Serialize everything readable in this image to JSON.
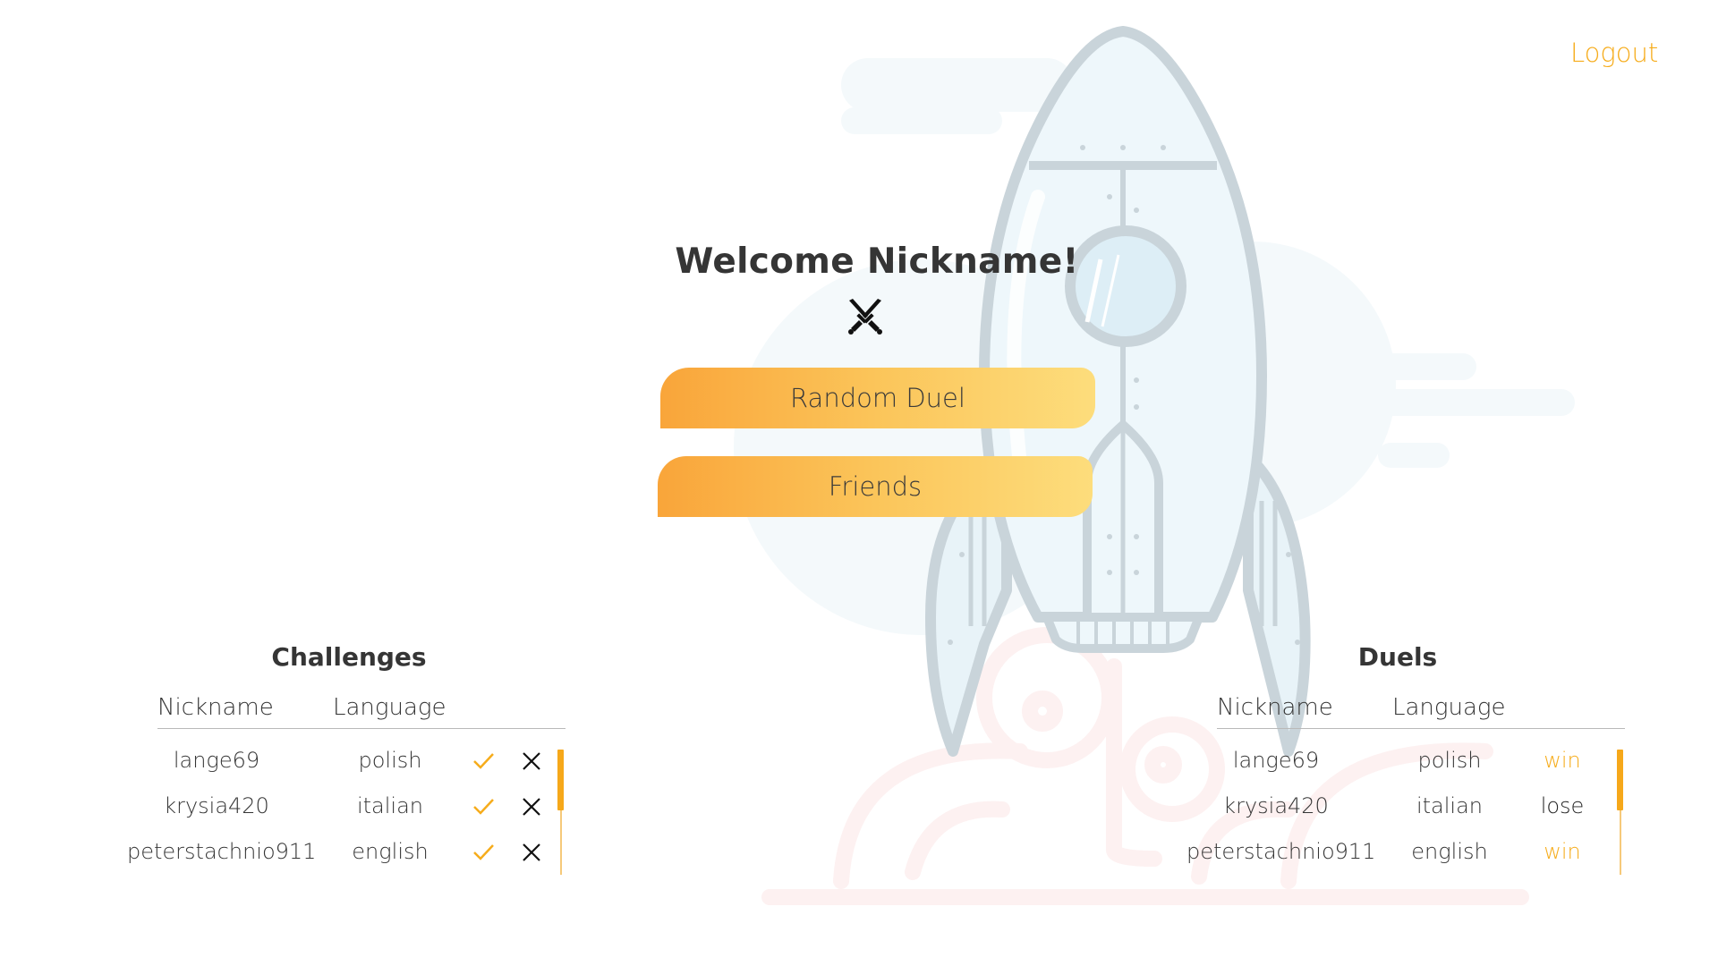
{
  "header": {
    "logout_label": "Logout"
  },
  "main": {
    "welcome_text": "Welcome Nickname!",
    "icon": "crossed-swords-icon",
    "random_duel_label": "Random Duel",
    "friends_label": "Friends"
  },
  "challenges": {
    "title": "Challenges",
    "columns": [
      "Nickname",
      "Language"
    ],
    "rows": [
      {
        "nickname": "lange69",
        "language": "polish"
      },
      {
        "nickname": "krysia420",
        "language": "italian"
      },
      {
        "nickname": "peterstachnio911",
        "language": "english"
      }
    ]
  },
  "duels": {
    "title": "Duels",
    "columns": [
      "Nickname",
      "Language"
    ],
    "rows": [
      {
        "nickname": "lange69",
        "language": "polish",
        "result": "win"
      },
      {
        "nickname": "krysia420",
        "language": "italian",
        "result": "lose"
      },
      {
        "nickname": "peterstachnio911",
        "language": "english",
        "result": "win"
      }
    ]
  },
  "colors": {
    "accent": "#f6ac1b",
    "button_gradient_start": "#f9a53a",
    "button_gradient_end": "#fddd7c",
    "text": "#353535"
  }
}
